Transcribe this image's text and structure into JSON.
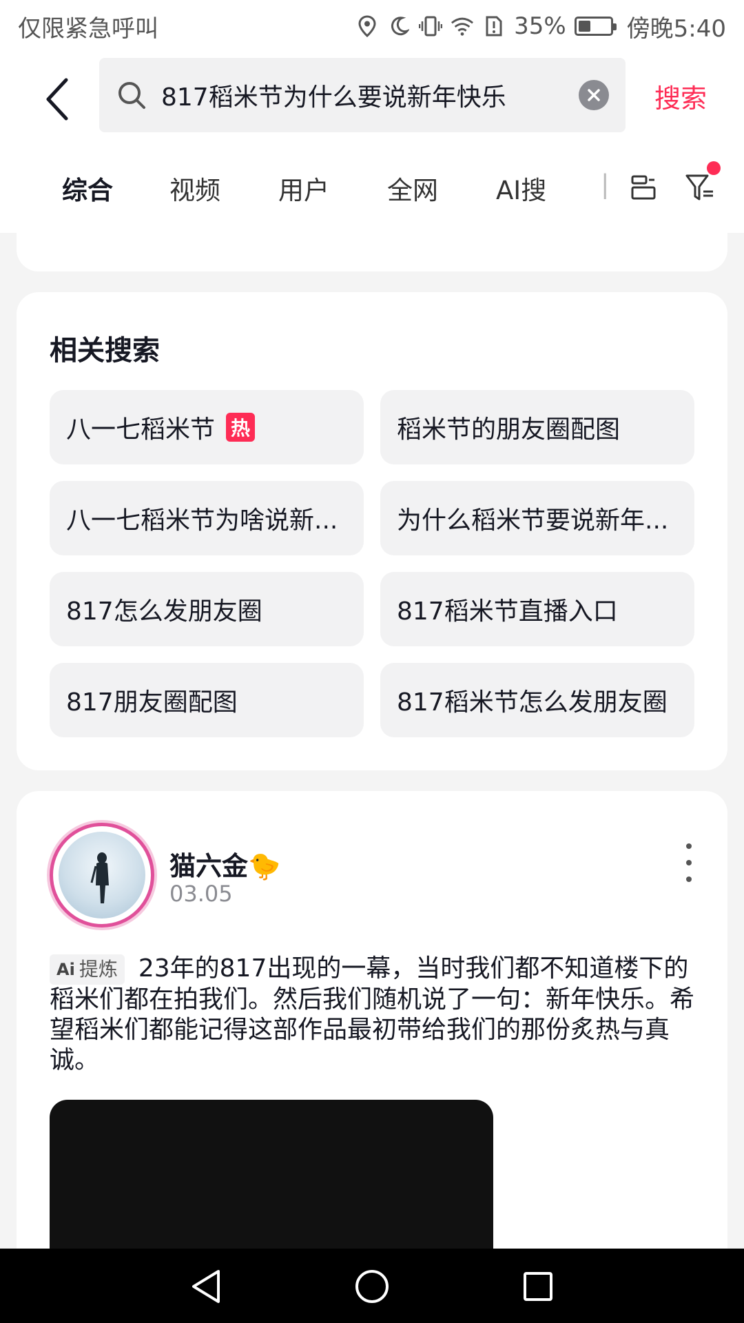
{
  "status_bar": {
    "left_text": "仅限紧急呼叫",
    "battery": "35%",
    "time": "傍晚5:40"
  },
  "header": {
    "search_query": "817稻米节为什么要说新年快乐",
    "search_action": "搜索"
  },
  "tabs": {
    "items": [
      "综合",
      "视频",
      "用户",
      "全网",
      "AI搜"
    ],
    "active": "综合"
  },
  "related_searches": {
    "title": "相关搜索",
    "items": [
      {
        "label": "八一七稻米节",
        "badge": "热"
      },
      {
        "label": "稻米节的朋友圈配图"
      },
      {
        "label": "八一七稻米节为啥说新..."
      },
      {
        "label": "为什么稻米节要说新年..."
      },
      {
        "label": "817怎么发朋友圈"
      },
      {
        "label": "817稻米节直播入口"
      },
      {
        "label": "817朋友圈配图"
      },
      {
        "label": "817稻米节怎么发朋友圈"
      }
    ]
  },
  "post": {
    "author": "猫六金🐤",
    "date": "03.05",
    "ai_tag": "提炼",
    "ai_tag_prefix": "Ai",
    "text": "23年的817出现的一幕，当时我们都不知道楼下的稻米们都在拍我们。然后我们随机说了一句：新年快乐。希望稻米们都能记得这部作品最初带给我们的那份炙热与真诚。"
  },
  "colors": {
    "accent": "#fe2c55",
    "text_primary": "#161823",
    "text_secondary": "#8a8b91",
    "chip_bg": "#f2f2f3",
    "page_bg": "#f4f4f4"
  }
}
